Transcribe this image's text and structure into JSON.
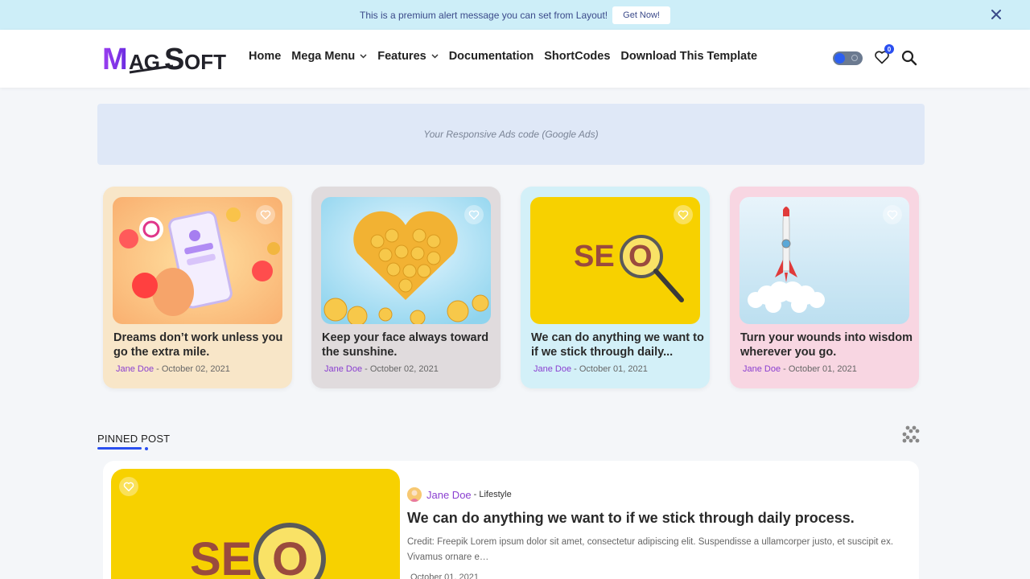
{
  "alert": {
    "message": "This is a premium alert message you can set from Layout!",
    "button": "Get Now!"
  },
  "header": {
    "logo_text": "MagSoft",
    "nav": [
      {
        "label": "Home",
        "has_dropdown": false
      },
      {
        "label": "Mega Menu",
        "has_dropdown": true
      },
      {
        "label": "Features",
        "has_dropdown": true
      },
      {
        "label": "Documentation",
        "has_dropdown": false
      },
      {
        "label": "ShortCodes",
        "has_dropdown": false
      },
      {
        "label": "Download This Template",
        "has_dropdown": false
      }
    ],
    "wishlist_count": "0"
  },
  "ad": {
    "text": "Your Responsive Ads code (Google Ads)"
  },
  "cards": [
    {
      "title": "Dreams don’t work unless you go the extra mile.",
      "author": "Jane Doe",
      "sep": " - ",
      "date": "October 02, 2021",
      "bg": "#f8e6c8",
      "icon": "social-phone-image"
    },
    {
      "title": "Keep your face always toward the sunshine.",
      "author": "Jane Doe",
      "sep": " - ",
      "date": "October 02, 2021",
      "bg": "#e0dbdd",
      "icon": "emoji-heart-image"
    },
    {
      "title": "We can do anything we want to if we stick through daily...",
      "author": "Jane Doe",
      "sep": " - ",
      "date": "October 01, 2021",
      "bg": "#d3f0f8",
      "icon": "seo-magnifier-image"
    },
    {
      "title": "Turn your wounds into wisdom wherever you go.",
      "author": "Jane Doe",
      "sep": " - ",
      "date": "October 01, 2021",
      "bg": "#f8d6e2",
      "icon": "rocket-image"
    }
  ],
  "pinned": {
    "label": "PINNED POST",
    "author": "Jane Doe",
    "sep": "-",
    "category": "Lifestyle",
    "title": "We can do anything we want to if we stick through daily process.",
    "excerpt": "Credit: Freepik Lorem ipsum dolor sit amet, consectetur adipiscing elit. Suspendisse a ullamcorper justo, et suscipit ex. Vivamus ornare e…",
    "date": "October 01, 2021",
    "seo_text": "SEO"
  },
  "colors": {
    "accent": "#2a4ff0",
    "author": "#8a3fd0",
    "seo_yellow": "#f7d100"
  }
}
